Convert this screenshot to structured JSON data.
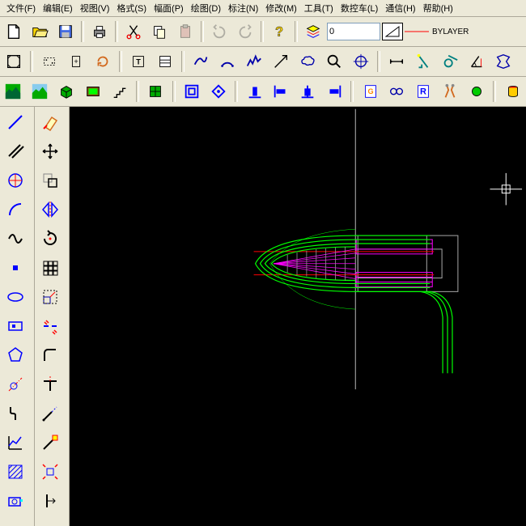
{
  "menu": {
    "file": "文件(F)",
    "edit": "编辑(E)",
    "view": "视图(V)",
    "format": "格式(S)",
    "area": "幅面(P)",
    "draw": "绘图(D)",
    "annotate": "标注(N)",
    "modify": "修改(M)",
    "tools": "工具(T)",
    "cnc": "数控车(L)",
    "comm": "通信(H)",
    "help": "帮助(H)"
  },
  "layer": {
    "value": "0"
  },
  "linetype": {
    "label": "BYLAYER"
  }
}
